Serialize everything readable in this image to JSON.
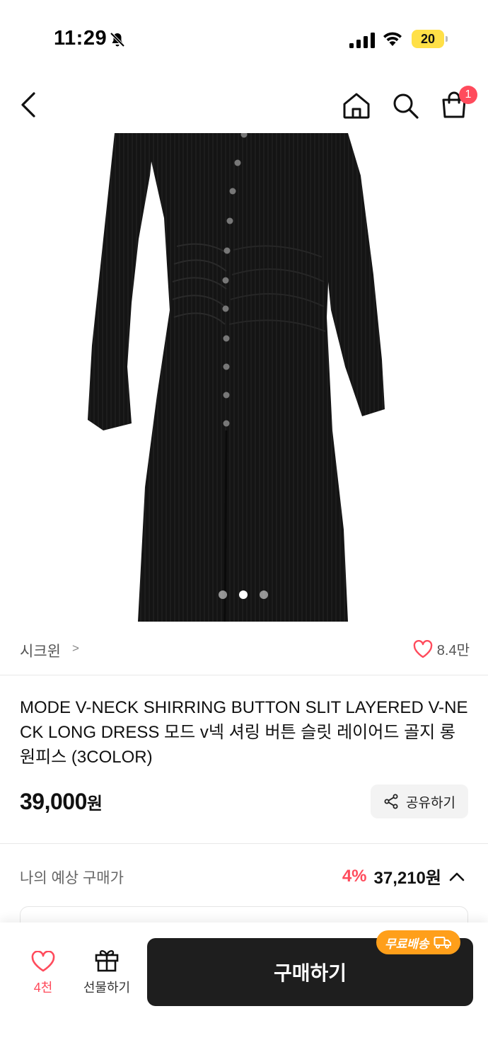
{
  "status_bar": {
    "time": "11:29",
    "battery": "20"
  },
  "nav": {
    "cart_count": "1"
  },
  "gallery": {
    "total": 3,
    "current": 2
  },
  "brand": {
    "name": "시크윈",
    "chevron": ">",
    "likes": "8.4만"
  },
  "product": {
    "title": "MODE V-NECK SHIRRING BUTTON SLIT LAYERED V-NECK LONG DRESS  모드 v넥 셔링 버튼 슬릿 레이어드 골지 롱원피스 (3COLOR)",
    "price": "39,000",
    "price_unit": "원",
    "share_label": "공유하기"
  },
  "expected": {
    "label": "나의 예상 구매가",
    "discount": "4%",
    "price": "37,210원"
  },
  "bottom_bar": {
    "wish_count": "4천",
    "gift_label": "선물하기",
    "buy_label": "구매하기",
    "free_shipping": "무료배송"
  },
  "colors": {
    "accent": "#ff4b5c",
    "buy_button": "#1e1e1e",
    "shipping_badge": "#ff9f1a"
  }
}
